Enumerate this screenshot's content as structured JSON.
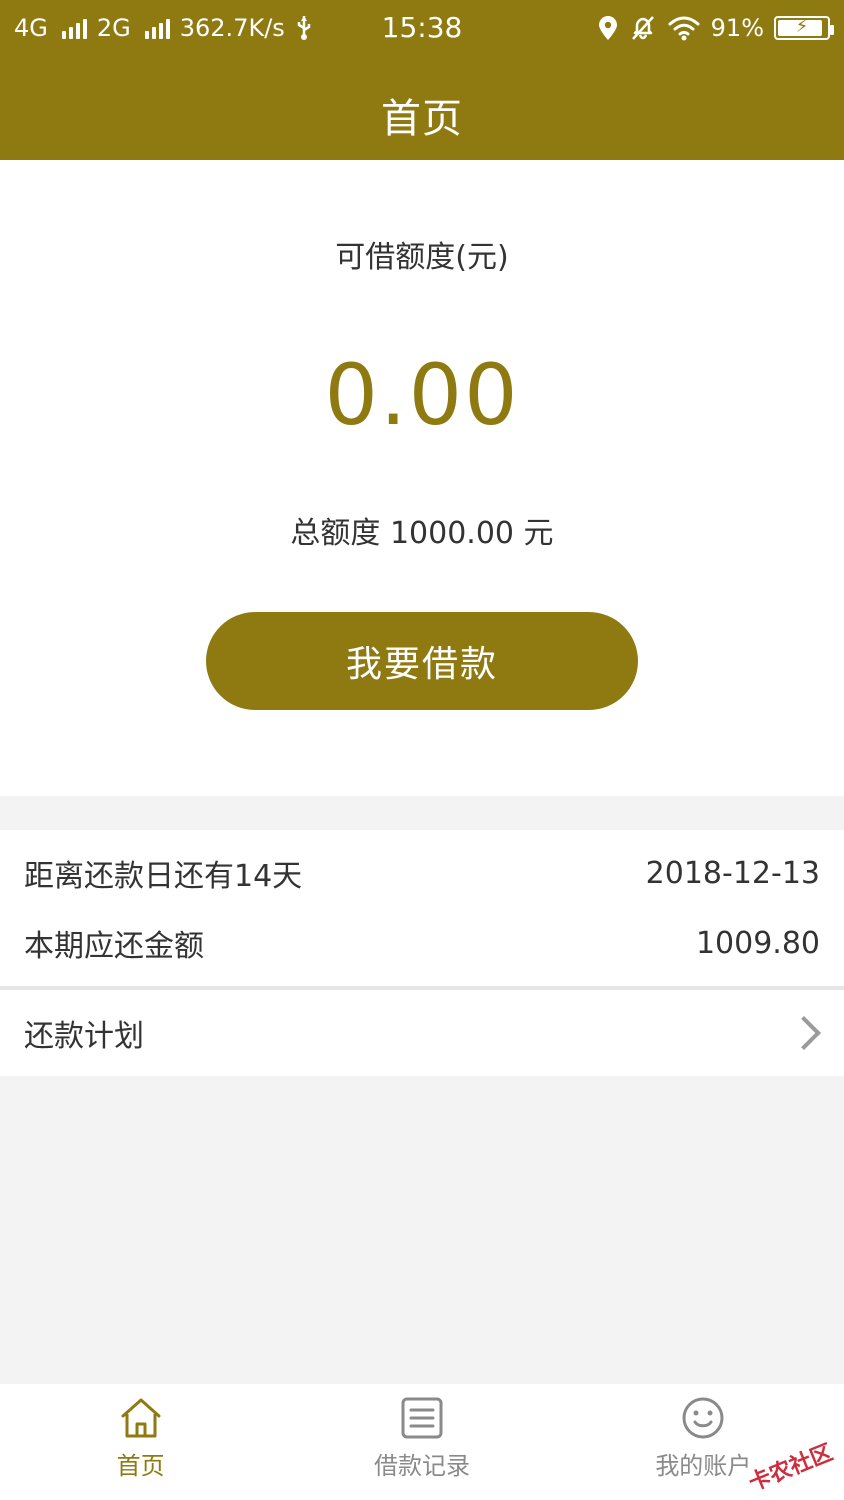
{
  "status_bar": {
    "left": [
      "4G",
      "2G",
      "362.7K/s"
    ],
    "time": "15:38",
    "battery_percent": "91%",
    "battery_level": 0.91
  },
  "header": {
    "title": "首页"
  },
  "main": {
    "available_label": "可借额度(元)",
    "available_amount": "0.00",
    "total_text": "总额度 1000.00 元",
    "borrow_button": "我要借款"
  },
  "repayment": {
    "days_left_label": "距离还款日还有14天",
    "due_date": "2018-12-13",
    "amount_due_label": "本期应还金额",
    "amount_due": "1009.80"
  },
  "plan": {
    "label": "还款计划"
  },
  "bottom_nav": [
    {
      "label": "首页",
      "icon": "home-icon",
      "active": true
    },
    {
      "label": "借款记录",
      "icon": "list-icon",
      "active": false
    },
    {
      "label": "我的账户",
      "icon": "smile-icon",
      "active": false
    }
  ],
  "watermark": "卡农社区",
  "colors": {
    "brand": "#8f7a12",
    "background": "#f3f3f3",
    "text": "#333333"
  }
}
